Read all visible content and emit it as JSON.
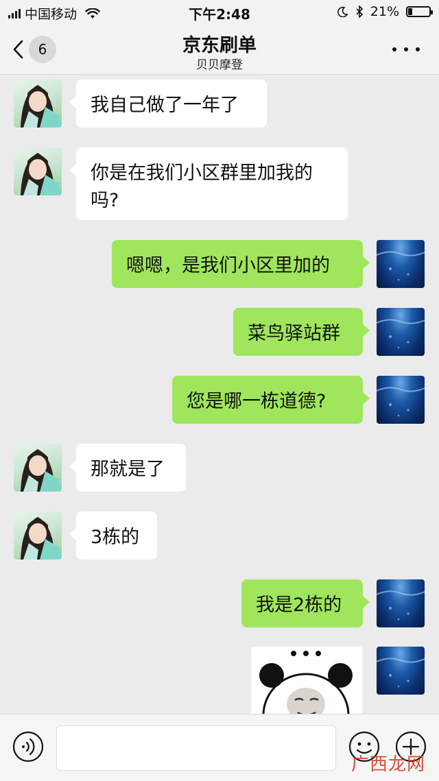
{
  "status_bar": {
    "carrier": "中国移动",
    "time": "下午2:48",
    "battery": "21%",
    "battery_level": 0.21
  },
  "nav": {
    "unread_count": "6",
    "title": "京东刷单",
    "subtitle": "贝贝摩登"
  },
  "messages": [
    {
      "side": "left",
      "text": "我自己做了一年了"
    },
    {
      "side": "left",
      "text": "你是在我们小区群里加我的吗?"
    },
    {
      "side": "right",
      "text": "嗯嗯，是我们小区里加的"
    },
    {
      "side": "right",
      "text": "菜鸟驿站群"
    },
    {
      "side": "right",
      "text": "您是哪一栋道德?"
    },
    {
      "side": "left",
      "text": "那就是了"
    },
    {
      "side": "left",
      "text": "3栋的"
    },
    {
      "side": "right",
      "text": "我是2栋的"
    },
    {
      "side": "right",
      "type": "sticker",
      "text": ""
    }
  ],
  "watermark": "广西龙网"
}
